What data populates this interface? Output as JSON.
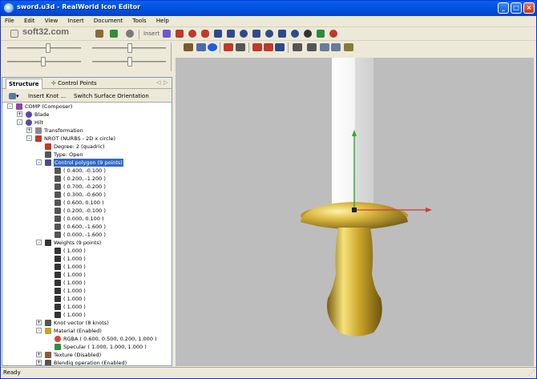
{
  "window": {
    "title": "sword.u3d - RealWorld Icon Editor"
  },
  "menu": [
    "File",
    "Edit",
    "View",
    "Insert",
    "Document",
    "Tools",
    "Help"
  ],
  "toolbar": {
    "insert_label": "Insert",
    "watermark": "soft32.com"
  },
  "panel": {
    "tab_structure": "Structure",
    "tab_control_points": "Control Points",
    "insert_knot": "Insert Knot ...",
    "switch_surface": "Switch Surface Orientation"
  },
  "tree": [
    {
      "label": "COMP (Composer)",
      "level": 0,
      "exp": "-",
      "icon": "composer-icon"
    },
    {
      "label": "Blade",
      "level": 1,
      "exp": "+",
      "icon": "object-icon"
    },
    {
      "label": "Hilt",
      "level": 1,
      "exp": "-",
      "icon": "object-icon"
    },
    {
      "label": "Transformation",
      "level": 2,
      "exp": "+",
      "icon": "transform-icon"
    },
    {
      "label": "NROT (NURBS - 2D x circle)",
      "level": 2,
      "exp": "-",
      "icon": "nurbs-icon"
    },
    {
      "label": "Degree: 2 (quadric)",
      "level": 3,
      "exp": "",
      "icon": "degree-icon"
    },
    {
      "label": "Type: Open",
      "level": 3,
      "exp": "",
      "icon": "type-icon"
    },
    {
      "label": "Control polygon (9 points)",
      "level": 3,
      "exp": "-",
      "icon": "polygon-icon",
      "selected": true
    },
    {
      "label": "( 0.400, -0.100 )",
      "level": 4,
      "exp": "",
      "icon": "point-icon"
    },
    {
      "label": "( 0.200, -1.200 )",
      "level": 4,
      "exp": "",
      "icon": "point-icon"
    },
    {
      "label": "( 0.700, -0.200 )",
      "level": 4,
      "exp": "",
      "icon": "point-icon"
    },
    {
      "label": "( 0.300, -0.600 )",
      "level": 4,
      "exp": "",
      "icon": "point-icon"
    },
    {
      "label": "( 0.600, 0.100 )",
      "level": 4,
      "exp": "",
      "icon": "point-icon"
    },
    {
      "label": "( 0.200, -0.100 )",
      "level": 4,
      "exp": "",
      "icon": "point-icon"
    },
    {
      "label": "( 0.000, 0.100 )",
      "level": 4,
      "exp": "",
      "icon": "point-icon"
    },
    {
      "label": "( 0.600, -1.600 )",
      "level": 4,
      "exp": "",
      "icon": "point-icon"
    },
    {
      "label": "( 0.000, -1.600 )",
      "level": 4,
      "exp": "",
      "icon": "point-icon"
    },
    {
      "label": "Weights (9 points)",
      "level": 3,
      "exp": "-",
      "icon": "scale-icon"
    },
    {
      "label": "( 1.000 )",
      "level": 4,
      "exp": "",
      "icon": "weight-icon"
    },
    {
      "label": "( 1.000 )",
      "level": 4,
      "exp": "",
      "icon": "weight-icon"
    },
    {
      "label": "( 1.000 )",
      "level": 4,
      "exp": "",
      "icon": "weight-icon"
    },
    {
      "label": "( 1.000 )",
      "level": 4,
      "exp": "",
      "icon": "weight-icon"
    },
    {
      "label": "( 1.000 )",
      "level": 4,
      "exp": "",
      "icon": "weight-icon"
    },
    {
      "label": "( 1.000 )",
      "level": 4,
      "exp": "",
      "icon": "weight-icon"
    },
    {
      "label": "( 1.000 )",
      "level": 4,
      "exp": "",
      "icon": "weight-icon"
    },
    {
      "label": "( 1.000 )",
      "level": 4,
      "exp": "",
      "icon": "weight-icon"
    },
    {
      "label": "( 1.000 )",
      "level": 4,
      "exp": "",
      "icon": "weight-icon"
    },
    {
      "label": "Knot vector (8 knots)",
      "level": 3,
      "exp": "+",
      "icon": "knot-icon"
    },
    {
      "label": "Material (Enabled)",
      "level": 3,
      "exp": "-",
      "icon": "material-icon"
    },
    {
      "label": "RGBA ( 0.600, 0.500, 0.200, 1.000 )",
      "level": 4,
      "exp": "",
      "icon": "rgba-icon"
    },
    {
      "label": "Specular ( 1.000, 1.000, 1.000 )",
      "level": 4,
      "exp": "",
      "icon": "specular-icon"
    },
    {
      "label": "Texture (Disabled)",
      "level": 3,
      "exp": "+",
      "icon": "texture-icon"
    },
    {
      "label": "Blendig operation (Enabled)",
      "level": 3,
      "exp": "+",
      "icon": "blend-icon"
    }
  ],
  "status": {
    "text": "Ready"
  },
  "colors": {
    "selection": "#316AC5",
    "gold": "#C9A227",
    "viewport_bg": "#BDBDBD"
  }
}
